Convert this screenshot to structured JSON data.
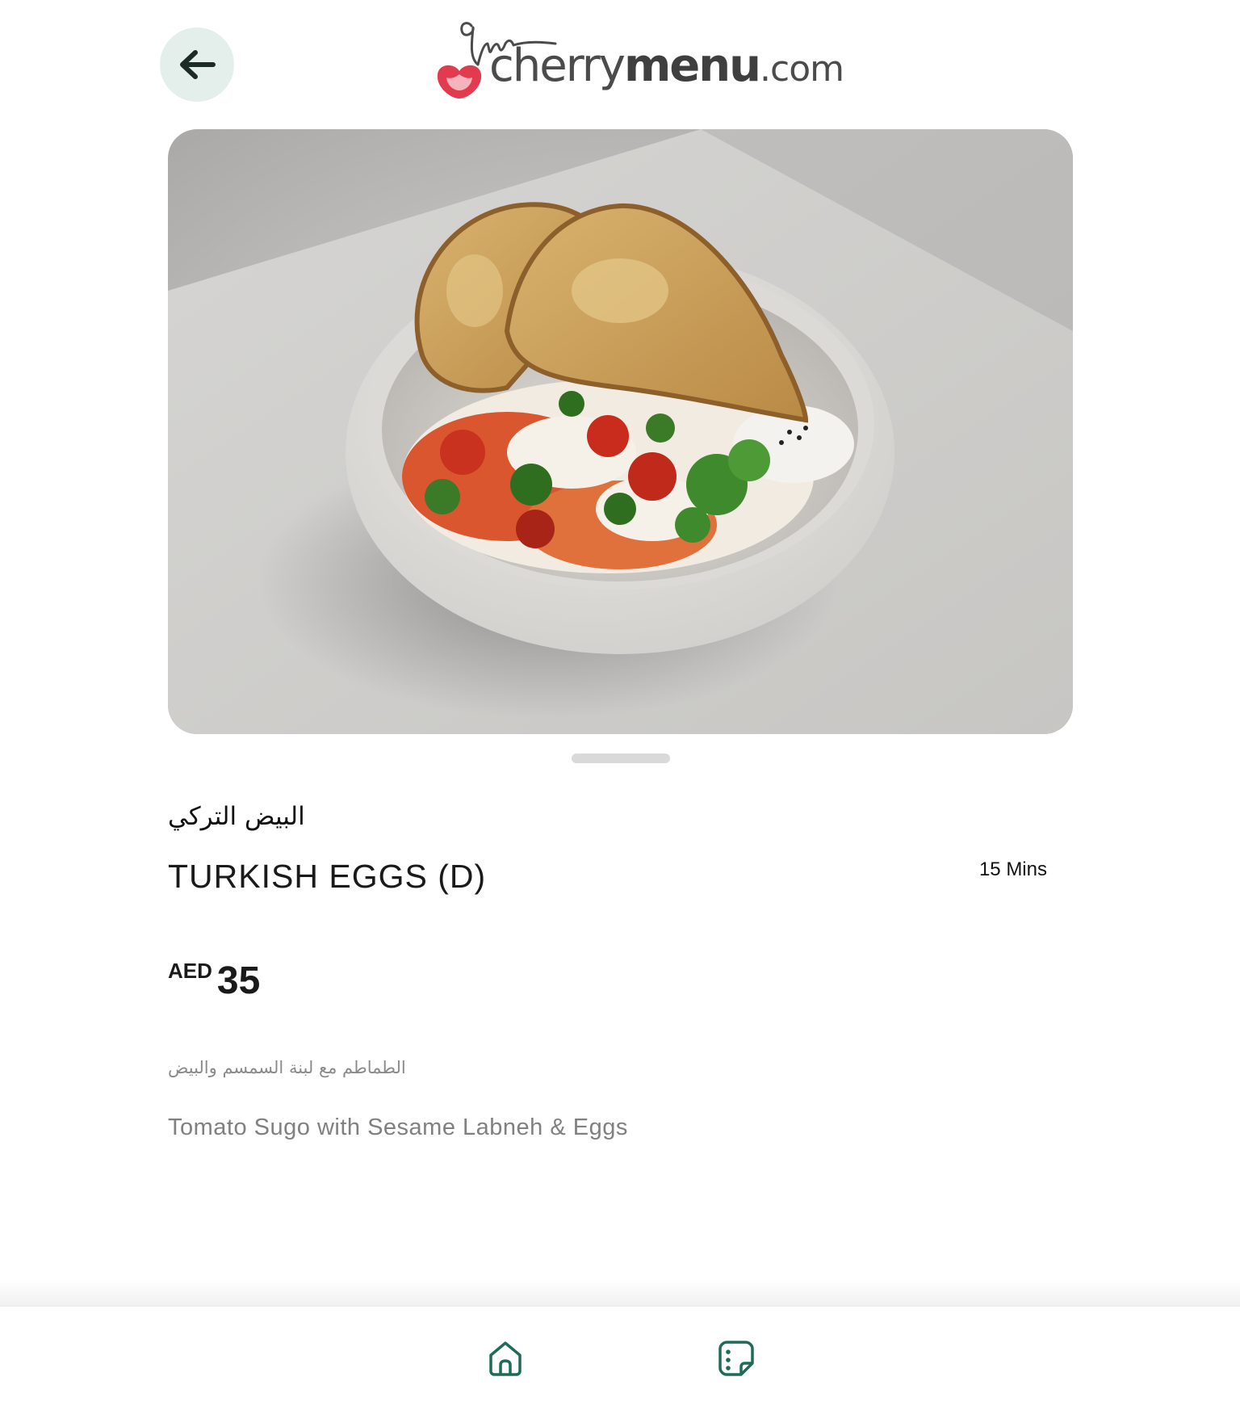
{
  "header": {
    "back_icon": "arrow-left-icon",
    "logo": {
      "text_light": "cherry",
      "text_bold": "menu",
      "text_domain": ".com",
      "brand_color": "#e23a4f",
      "text_color": "#4b4b4b"
    }
  },
  "item": {
    "image": "turkish-eggs-photo",
    "name_ar": "البيض التركي",
    "name_en": "TURKISH EGGS (D)",
    "prep_time": "15 Mins",
    "price": {
      "currency": "AED",
      "amount": "35"
    },
    "description_ar": "الطماطم مع لبنة السمسم والبيض",
    "description_en": "Tomato Sugo with Sesame Labneh & Eggs"
  },
  "carousel": {
    "current": 1
  },
  "bottom_nav": {
    "items": [
      {
        "icon": "home-icon"
      },
      {
        "icon": "menu-card-icon"
      }
    ],
    "accent_color": "#1e6b57"
  }
}
